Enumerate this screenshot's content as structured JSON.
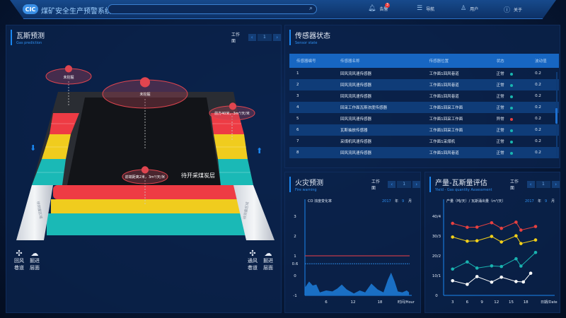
{
  "header": {
    "logo": "CIC",
    "title": "煤矿安全生产预警系统",
    "search_placeholder": "",
    "nav": [
      {
        "icon": "bell-icon",
        "label": "告警",
        "badge": "3"
      },
      {
        "icon": "list-icon",
        "label": "导航"
      },
      {
        "icon": "user-icon",
        "label": "用户"
      },
      {
        "icon": "info-icon",
        "label": "关于"
      }
    ]
  },
  "gas": {
    "title": "瓦斯预测",
    "subtitle": "Gas prediction",
    "pager_label": "工作面",
    "page": "1",
    "markers": [
      "未挖掘",
      "未挖掘",
      "前方40米，3m³/天/米",
      "前端距离2米，3m³/天/米"
    ],
    "seam_label": "待开采煤炭层",
    "side_labels": [
      "待测量区域",
      "待测量区域"
    ],
    "legend": [
      {
        "icon": "fan-icon",
        "label1": "回风",
        "label2": "巷道"
      },
      {
        "icon": "excavator-icon",
        "label1": "掘进",
        "label2": "层面"
      },
      {
        "icon": "fan-icon",
        "label1": "通风",
        "label2": "巷道"
      },
      {
        "icon": "excavator-icon",
        "label1": "掘进",
        "label2": "层面"
      }
    ],
    "colors": {
      "red": "#ee3b44",
      "yellow": "#f0cc1e",
      "teal": "#1ab9b6"
    }
  },
  "sensor": {
    "title": "传感器状态",
    "subtitle": "Sensor state",
    "columns": [
      "传感器编号",
      "传感器名称",
      "传感器位置",
      "状态",
      "波动值"
    ],
    "rows": [
      [
        "1",
        "回风流风速传感器",
        "工作面1回风巷道",
        "正常",
        "0.2"
      ],
      [
        "2",
        "回风流风速传感器",
        "工作面1回风巷道",
        "正常",
        "0.2"
      ],
      [
        "3",
        "回风流风速传感器",
        "工作面1回风巷道",
        "正常",
        "0.2"
      ],
      [
        "4",
        "回采工作面瓦斯浓度传感器",
        "工作面1回采工作面",
        "正常",
        "0.2"
      ],
      [
        "5",
        "回风流风速传感器",
        "工作面1回采工作面",
        "异常",
        "0.2"
      ],
      [
        "6",
        "瓦斯抽放传感器",
        "工作面1回采工作面",
        "正常",
        "0.2"
      ],
      [
        "7",
        "采煤机风速传感器",
        "工作面1采煤机",
        "正常",
        "0.2"
      ],
      [
        "8",
        "回风流风速传感器",
        "工作面1回风巷道",
        "正常",
        "0.2"
      ]
    ],
    "status_colors": {
      "正常": "#19b6b0",
      "异常": "#e8403f"
    }
  },
  "fire": {
    "title": "火灾预测",
    "subtitle": "Fire warning",
    "pager_label": "工作面",
    "page": "1",
    "year": "2017",
    "year_unit": "年",
    "month": "9",
    "month_unit": "月"
  },
  "yield": {
    "title": "产量-瓦斯量评估",
    "subtitle": "Yield - Gas quantity Assessment",
    "pager_label": "工作面",
    "page": "1",
    "year": "2017",
    "year_unit": "年",
    "month": "9",
    "month_unit": "月"
  },
  "chart_data": [
    {
      "type": "area",
      "ylabel": "CO 浓度变化率",
      "xlabel": "时间/Hour",
      "xticks": [
        6,
        12,
        18
      ],
      "yticks": [
        "3",
        "2",
        "1",
        "0.6",
        "0",
        "-1"
      ],
      "ylim": [
        -1,
        3.5
      ],
      "xlim": [
        0,
        25
      ],
      "thresholds": [
        {
          "value": 1,
          "style": "solid",
          "color": "#c0394a"
        },
        {
          "value": 0.6,
          "style": "dashed",
          "color": "#2e8ff0"
        }
      ],
      "color": "#1a6fc4",
      "points": [
        [
          1.3,
          -0.6
        ],
        [
          2.2,
          -0.3
        ],
        [
          3,
          -0.5
        ],
        [
          3.8,
          -0.45
        ],
        [
          4.6,
          -0.85
        ],
        [
          6,
          -0.75
        ],
        [
          7.4,
          -0.8
        ],
        [
          8.5,
          -0.65
        ],
        [
          9.5,
          -0.45
        ],
        [
          10.6,
          -0.7
        ],
        [
          12.2,
          -0.9
        ],
        [
          13.5,
          -0.75
        ],
        [
          14.7,
          -0.85
        ],
        [
          16.1,
          -0.4
        ],
        [
          17.5,
          -0.7
        ],
        [
          18.8,
          -0.85
        ],
        [
          19.8,
          -0.2
        ],
        [
          20.5,
          0.15
        ],
        [
          21.3,
          -0.3
        ],
        [
          22,
          -0.8
        ],
        [
          23,
          -0.85
        ],
        [
          24,
          -0.75
        ],
        [
          24.5,
          -0.85
        ]
      ]
    },
    {
      "type": "line",
      "ylabel": "产量（吨/天）/ 瓦斯涌出量（m³/天）",
      "xlabel": "日期/Date",
      "xticks": [
        3,
        6,
        9,
        12,
        15,
        18
      ],
      "yticks": [
        "0",
        "10/1",
        "20/2",
        "30/3",
        "40/4"
      ],
      "ylim": [
        0,
        45
      ],
      "xlim": [
        0,
        22
      ],
      "series": [
        {
          "color": "#e8403f",
          "x": [
            3,
            6,
            8,
            11,
            13,
            16,
            17,
            20
          ],
          "values": [
            36.4,
            34.4,
            34.5,
            36.7,
            33.9,
            37,
            33,
            34.8
          ]
        },
        {
          "color": "#f3d019",
          "x": [
            3,
            6,
            8,
            11,
            13,
            16,
            17,
            20
          ],
          "values": [
            29.5,
            27.4,
            27.6,
            29.8,
            27,
            30.1,
            26.2,
            28
          ]
        },
        {
          "color": "#19b3b0",
          "x": [
            3,
            6,
            8,
            11,
            13,
            16,
            17,
            20
          ],
          "values": [
            13.3,
            16.9,
            13.8,
            14.9,
            14.6,
            18.5,
            14.8,
            21.7
          ]
        },
        {
          "color": "#ffffff",
          "x": [
            3,
            6,
            8,
            11,
            13,
            16,
            17.5,
            19
          ],
          "values": [
            7.4,
            5.6,
            9.5,
            6.7,
            9.2,
            7,
            6.8,
            11.2
          ]
        }
      ]
    }
  ]
}
